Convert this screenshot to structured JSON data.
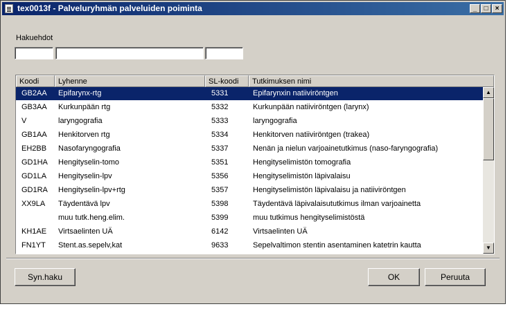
{
  "window": {
    "title": "tex0013f - Palveluryhmän palveluiden poiminta"
  },
  "search": {
    "label": "Hakuehdot"
  },
  "columns": [
    "Koodi",
    "Lyhenne",
    "SL-koodi",
    "Tutkimuksen nimi"
  ],
  "rows": [
    [
      "GB2AA",
      "Epifarynx-rtg",
      "5331",
      "Epifarynxin natiiviröntgen"
    ],
    [
      "GB3AA",
      "Kurkunpään rtg",
      "5332",
      "Kurkunpään natiiviröntgen (larynx)"
    ],
    [
      "V",
      "laryngografia",
      "5333",
      "laryngografia"
    ],
    [
      "GB1AA",
      "Henkitorven rtg",
      "5334",
      "Henkitorven natiiviröntgen (trakea)"
    ],
    [
      "EH2BB",
      "Nasofaryngografia",
      "5337",
      "Nenän ja nielun varjoainetutkimus (naso-faryngografia)"
    ],
    [
      "GD1HA",
      "Hengityselin-tomo",
      "5351",
      "Hengityselimistön tomografia"
    ],
    [
      "GD1LA",
      "Hengityselin-lpv",
      "5356",
      "Hengityselimistön läpivalaisu"
    ],
    [
      "GD1RA",
      "Hengityselin-lpv+rtg",
      "5357",
      "Hengityselimistön läpivalaisu ja natiiviröntgen"
    ],
    [
      "XX9LA",
      "Täydentävä lpv",
      "5398",
      "Täydentävä läpivalaisututkimus ilman varjoainetta"
    ],
    [
      "",
      "muu tutk.heng.elim.",
      "5399",
      "muu tutkimus hengityselimistöstä"
    ],
    [
      "KH1AE",
      "Virtsaelinten UÄ",
      "6142",
      "Virtsaelinten UÄ"
    ],
    [
      "FN1YT",
      "Stent.as.sepelv,kat",
      "9633",
      "Sepelvaltimon stentin asentaminen katetrin kautta"
    ]
  ],
  "selected_row": 0,
  "buttons": {
    "syn": "Syn.haku",
    "ok": "OK",
    "cancel": "Peruuta"
  },
  "icons": {
    "app": "document-icon",
    "minimize": "minimize-icon",
    "maximize": "maximize-icon",
    "close": "close-icon"
  }
}
